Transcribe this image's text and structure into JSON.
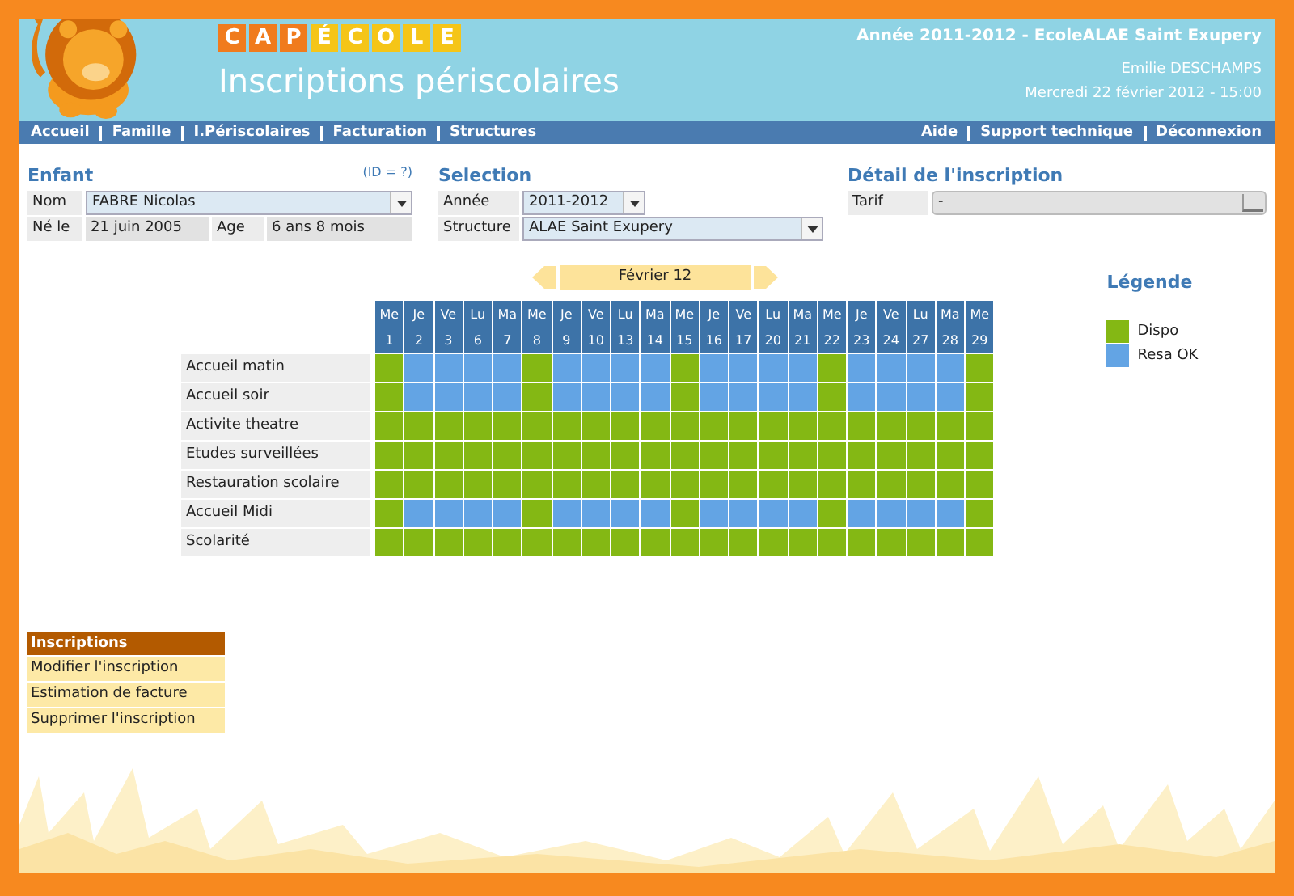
{
  "header": {
    "logo": [
      {
        "letter": "C",
        "color": "#f07b1d"
      },
      {
        "letter": "A",
        "color": "#f07b1d"
      },
      {
        "letter": "P",
        "color": "#f07b1d"
      },
      {
        "letter": "É",
        "color": "#f5c518"
      },
      {
        "letter": "C",
        "color": "#f5c518"
      },
      {
        "letter": "O",
        "color": "#f5c518"
      },
      {
        "letter": "L",
        "color": "#f5c518"
      },
      {
        "letter": "E",
        "color": "#f5c518"
      }
    ],
    "title": "Inscriptions périscolaires",
    "school": "Année 2011-2012 - EcoleALAE Saint Exupery",
    "user": "Emilie DESCHAMPS",
    "datetime": "Mercredi 22 février 2012 - 15:00"
  },
  "nav": {
    "left": [
      "Accueil",
      "Famille",
      "I.Périscolaires",
      "Facturation",
      "Structures"
    ],
    "right": [
      "Aide",
      "Support technique",
      "Déconnexion"
    ]
  },
  "enfant": {
    "title": "Enfant",
    "id_note": "(ID = ?)",
    "nom_label": "Nom",
    "nom": "FABRE Nicolas",
    "ne_label": "Né le",
    "ne": "21 juin 2005",
    "age_label": "Age",
    "age": "6 ans 8 mois"
  },
  "selection": {
    "title": "Selection",
    "annee_label": "Année",
    "annee": "2011-2012",
    "structure_label": "Structure",
    "structure": "ALAE Saint Exupery"
  },
  "detail": {
    "title": "Détail de l'inscription",
    "tarif_label": "Tarif",
    "tarif": "-"
  },
  "calendar": {
    "month": "Février 12",
    "days": [
      {
        "d": "Me",
        "n": "1"
      },
      {
        "d": "Je",
        "n": "2"
      },
      {
        "d": "Ve",
        "n": "3"
      },
      {
        "d": "Lu",
        "n": "6"
      },
      {
        "d": "Ma",
        "n": "7"
      },
      {
        "d": "Me",
        "n": "8"
      },
      {
        "d": "Je",
        "n": "9"
      },
      {
        "d": "Ve",
        "n": "10"
      },
      {
        "d": "Lu",
        "n": "13"
      },
      {
        "d": "Ma",
        "n": "14"
      },
      {
        "d": "Me",
        "n": "15"
      },
      {
        "d": "Je",
        "n": "16"
      },
      {
        "d": "Ve",
        "n": "17"
      },
      {
        "d": "Lu",
        "n": "20"
      },
      {
        "d": "Ma",
        "n": "21"
      },
      {
        "d": "Me",
        "n": "22"
      },
      {
        "d": "Je",
        "n": "23"
      },
      {
        "d": "Ve",
        "n": "24"
      },
      {
        "d": "Lu",
        "n": "27"
      },
      {
        "d": "Ma",
        "n": "28"
      },
      {
        "d": "Me",
        "n": "29"
      }
    ],
    "rows": [
      {
        "label": "Accueil matin",
        "cells": [
          {
            "reserved": false
          },
          {
            "reserved": true
          },
          {
            "reserved": true
          },
          {
            "reserved": true
          },
          {
            "reserved": true
          },
          {
            "reserved": false
          },
          {
            "reserved": true
          },
          {
            "reserved": true
          },
          {
            "reserved": true
          },
          {
            "reserved": true
          },
          {
            "reserved": false
          },
          {
            "reserved": true
          },
          {
            "reserved": true
          },
          {
            "reserved": true
          },
          {
            "reserved": true
          },
          {
            "reserved": false
          },
          {
            "reserved": true
          },
          {
            "reserved": true
          },
          {
            "reserved": true
          },
          {
            "reserved": true
          },
          {
            "reserved": false
          }
        ]
      },
      {
        "label": "Accueil soir",
        "cells": [
          {
            "reserved": false
          },
          {
            "reserved": true
          },
          {
            "reserved": true
          },
          {
            "reserved": true
          },
          {
            "reserved": true
          },
          {
            "reserved": false
          },
          {
            "reserved": true
          },
          {
            "reserved": true
          },
          {
            "reserved": true
          },
          {
            "reserved": true
          },
          {
            "reserved": false
          },
          {
            "reserved": true
          },
          {
            "reserved": true
          },
          {
            "reserved": true
          },
          {
            "reserved": true
          },
          {
            "reserved": false
          },
          {
            "reserved": true
          },
          {
            "reserved": true
          },
          {
            "reserved": true
          },
          {
            "reserved": true
          },
          {
            "reserved": false
          }
        ]
      },
      {
        "label": "Activite theatre",
        "cells": [
          {
            "reserved": false
          },
          {
            "reserved": false
          },
          {
            "reserved": false
          },
          {
            "reserved": false
          },
          {
            "reserved": false
          },
          {
            "reserved": false
          },
          {
            "reserved": false
          },
          {
            "reserved": false
          },
          {
            "reserved": false
          },
          {
            "reserved": false
          },
          {
            "reserved": false
          },
          {
            "reserved": false
          },
          {
            "reserved": false
          },
          {
            "reserved": false
          },
          {
            "reserved": false
          },
          {
            "reserved": false
          },
          {
            "reserved": false
          },
          {
            "reserved": false
          },
          {
            "reserved": false
          },
          {
            "reserved": false
          },
          {
            "reserved": false
          }
        ]
      },
      {
        "label": "Etudes surveillées",
        "cells": [
          {
            "reserved": false
          },
          {
            "reserved": false
          },
          {
            "reserved": false
          },
          {
            "reserved": false
          },
          {
            "reserved": false
          },
          {
            "reserved": false
          },
          {
            "reserved": false
          },
          {
            "reserved": false
          },
          {
            "reserved": false
          },
          {
            "reserved": false
          },
          {
            "reserved": false
          },
          {
            "reserved": false
          },
          {
            "reserved": false
          },
          {
            "reserved": false
          },
          {
            "reserved": false
          },
          {
            "reserved": false
          },
          {
            "reserved": false
          },
          {
            "reserved": false
          },
          {
            "reserved": false
          },
          {
            "reserved": false
          },
          {
            "reserved": false
          }
        ]
      },
      {
        "label": "Restauration scolaire",
        "cells": [
          {
            "reserved": false
          },
          {
            "reserved": false
          },
          {
            "reserved": false
          },
          {
            "reserved": false
          },
          {
            "reserved": false
          },
          {
            "reserved": false
          },
          {
            "reserved": false
          },
          {
            "reserved": false
          },
          {
            "reserved": false
          },
          {
            "reserved": false
          },
          {
            "reserved": false
          },
          {
            "reserved": false
          },
          {
            "reserved": false
          },
          {
            "reserved": false
          },
          {
            "reserved": false
          },
          {
            "reserved": false
          },
          {
            "reserved": false
          },
          {
            "reserved": false
          },
          {
            "reserved": false
          },
          {
            "reserved": false
          },
          {
            "reserved": false
          }
        ]
      },
      {
        "label": "Accueil Midi",
        "cells": [
          {
            "reserved": false
          },
          {
            "reserved": true
          },
          {
            "reserved": true
          },
          {
            "reserved": true
          },
          {
            "reserved": true
          },
          {
            "reserved": false
          },
          {
            "reserved": true
          },
          {
            "reserved": true
          },
          {
            "reserved": true
          },
          {
            "reserved": true
          },
          {
            "reserved": false
          },
          {
            "reserved": true
          },
          {
            "reserved": true
          },
          {
            "reserved": true
          },
          {
            "reserved": true
          },
          {
            "reserved": false
          },
          {
            "reserved": true
          },
          {
            "reserved": true
          },
          {
            "reserved": true
          },
          {
            "reserved": true
          },
          {
            "reserved": false
          }
        ]
      },
      {
        "label": "Scolarité",
        "cells": [
          {
            "reserved": false
          },
          {
            "reserved": false
          },
          {
            "reserved": false
          },
          {
            "reserved": false
          },
          {
            "reserved": false
          },
          {
            "reserved": false
          },
          {
            "reserved": false
          },
          {
            "reserved": false
          },
          {
            "reserved": false
          },
          {
            "reserved": false
          },
          {
            "reserved": false
          },
          {
            "reserved": false
          },
          {
            "reserved": false
          },
          {
            "reserved": false
          },
          {
            "reserved": false
          },
          {
            "reserved": false
          },
          {
            "reserved": false
          },
          {
            "reserved": false
          },
          {
            "reserved": false
          },
          {
            "reserved": false
          },
          {
            "reserved": false
          }
        ]
      }
    ]
  },
  "legend": {
    "title": "Légende",
    "items": [
      {
        "kind": "dispo",
        "label": "Dispo",
        "color": "#84b814"
      },
      {
        "kind": "resa",
        "label": "Resa OK",
        "color": "#63a4e4"
      }
    ]
  },
  "actions": {
    "title": "Inscriptions",
    "items": [
      "Modifier l'inscription",
      "Estimation de facture",
      "Supprimer l'inscription"
    ]
  }
}
